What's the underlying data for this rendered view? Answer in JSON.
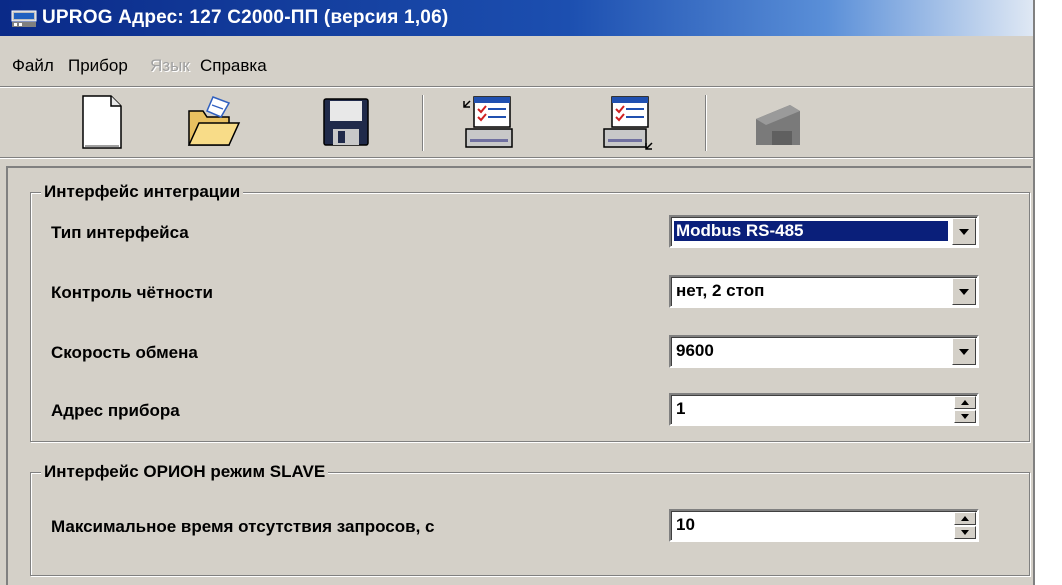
{
  "window": {
    "title": "UPROG  Адрес: 127  С2000-ПП (версия  1,06)"
  },
  "menu": [
    {
      "label": "Файл",
      "enabled": true
    },
    {
      "label": "Прибор",
      "enabled": true
    },
    {
      "label": "Язык",
      "enabled": false
    },
    {
      "label": "Справка",
      "enabled": true
    }
  ],
  "toolbar": {
    "buttons": [
      {
        "icon": "new-document-icon",
        "enabled": true
      },
      {
        "icon": "open-folder-icon",
        "enabled": true
      },
      {
        "icon": "save-floppy-icon",
        "enabled": true
      },
      {
        "icon": "read-from-device-icon",
        "enabled": true
      },
      {
        "icon": "write-to-device-icon",
        "enabled": true
      },
      {
        "icon": "device-icon",
        "enabled": false
      }
    ]
  },
  "integration_group": {
    "title": "Интерфейс интеграции",
    "interface_type": {
      "label": "Тип интерфейса",
      "value": "Modbus RS-485",
      "selected": true
    },
    "parity": {
      "label": "Контроль чётности",
      "value": "нет, 2 стоп"
    },
    "baud_rate": {
      "label": "Скорость обмена",
      "value": "9600"
    },
    "device_address": {
      "label": "Адрес прибора",
      "value": "1"
    }
  },
  "orion_group": {
    "title": "Интерфейс ОРИОН режим SLAVE",
    "max_idle": {
      "label": "Максимальное время отсутствия запросов, с",
      "value": "10"
    }
  }
}
